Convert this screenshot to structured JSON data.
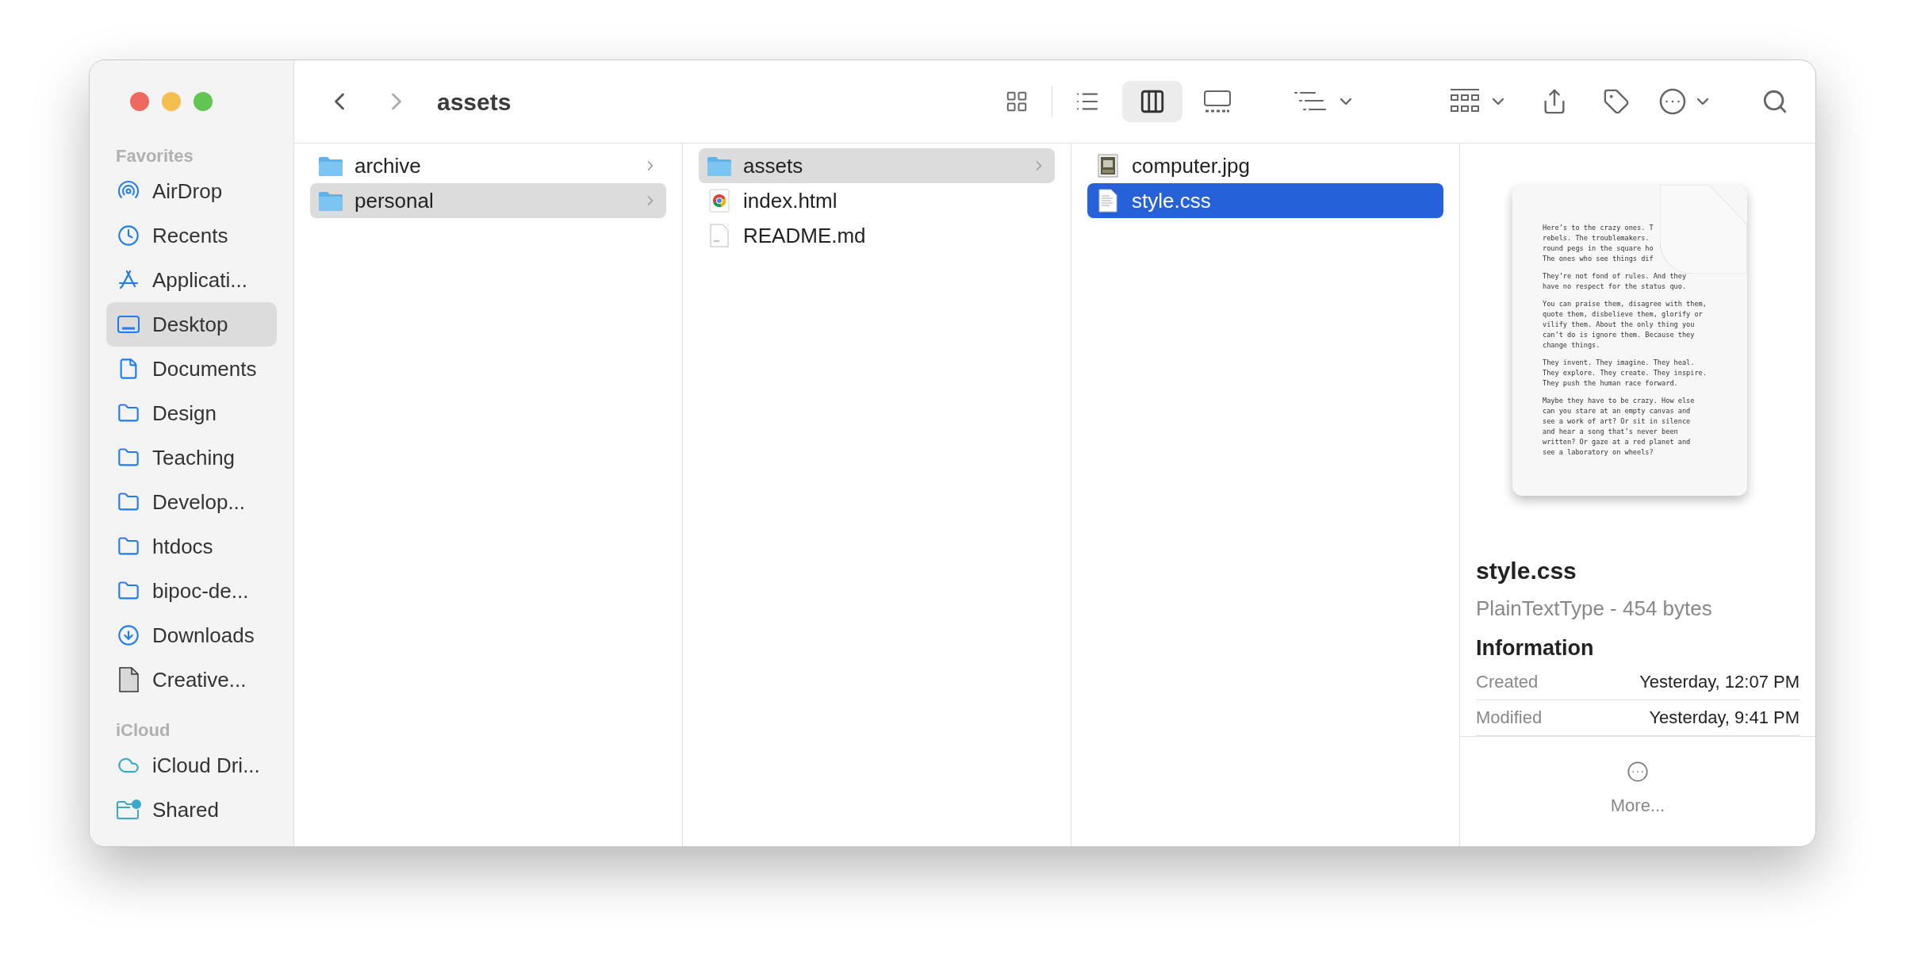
{
  "window": {
    "title": "assets"
  },
  "toolbar": {
    "views": [
      {
        "kind": "icons",
        "selected": false
      },
      {
        "kind": "list",
        "selected": false
      },
      {
        "kind": "columns",
        "selected": true
      },
      {
        "kind": "gallery",
        "selected": false
      }
    ]
  },
  "sidebar": {
    "sections": [
      {
        "heading": "Favorites",
        "items": [
          {
            "label": "AirDrop",
            "kind": "airdrop",
            "selected": false
          },
          {
            "label": "Recents",
            "kind": "recents",
            "selected": false
          },
          {
            "label": "Applicati...",
            "kind": "applications",
            "selected": false
          },
          {
            "label": "Desktop",
            "kind": "desktop",
            "selected": true
          },
          {
            "label": "Documents",
            "kind": "document",
            "selected": false
          },
          {
            "label": "Design",
            "kind": "folder",
            "selected": false
          },
          {
            "label": "Teaching",
            "kind": "folder",
            "selected": false
          },
          {
            "label": "Develop...",
            "kind": "folder",
            "selected": false
          },
          {
            "label": "htdocs",
            "kind": "folder",
            "selected": false
          },
          {
            "label": "bipoc-de...",
            "kind": "folder",
            "selected": false
          },
          {
            "label": "Downloads",
            "kind": "downloads",
            "selected": false
          },
          {
            "label": "Creative...",
            "kind": "file",
            "selected": false
          }
        ]
      },
      {
        "heading": "iCloud",
        "items": [
          {
            "label": "iCloud Dri...",
            "kind": "cloud",
            "selected": false
          },
          {
            "label": "Shared",
            "kind": "shared",
            "selected": false
          }
        ]
      }
    ]
  },
  "columns": [
    {
      "items": [
        {
          "name": "archive",
          "kind": "folder",
          "selected": false,
          "focused": false
        },
        {
          "name": "personal",
          "kind": "folder",
          "selected": true,
          "focused": false
        }
      ]
    },
    {
      "items": [
        {
          "name": "assets",
          "kind": "folder",
          "selected": true,
          "focused": false
        },
        {
          "name": "index.html",
          "kind": "html",
          "selected": false,
          "focused": false
        },
        {
          "name": "README.md",
          "kind": "markdown",
          "selected": false,
          "focused": false
        }
      ]
    },
    {
      "items": [
        {
          "name": "computer.jpg",
          "kind": "image",
          "selected": false,
          "focused": false
        },
        {
          "name": "style.css",
          "kind": "text",
          "selected": true,
          "focused": true
        }
      ]
    }
  ],
  "preview": {
    "paragraphs": [
      [
        "Here’s to the crazy ones. T",
        "rebels. The troublemakers.",
        "round pegs in the square ho",
        "The ones who see things dif"
      ],
      [
        "They’re not fond of rules. And they",
        "have no respect for the status quo."
      ],
      [
        "You can praise them, disagree with them,",
        "quote them, disbelieve them, glorify or",
        "vilify them. About the only thing you",
        "can’t do is ignore them. Because they",
        "change things."
      ],
      [
        "They invent. They imagine. They heal.",
        "They explore. They create. They inspire.",
        "They push the human race forward."
      ],
      [
        "Maybe they have to be crazy. How else",
        "can you stare at an empty canvas and",
        "see a work of art? Or sit in silence",
        "and hear a song that’s never been",
        "written? Or gaze at a red planet and",
        "see a laboratory on wheels?"
      ]
    ],
    "filename": "style.css",
    "subtitle": "PlainTextType - 454 bytes",
    "section": "Information",
    "rows": [
      {
        "label": "Created",
        "value": "Yesterday, 12:07 PM"
      },
      {
        "label": "Modified",
        "value": "Yesterday, 9:41 PM"
      }
    ],
    "more": "More..."
  }
}
